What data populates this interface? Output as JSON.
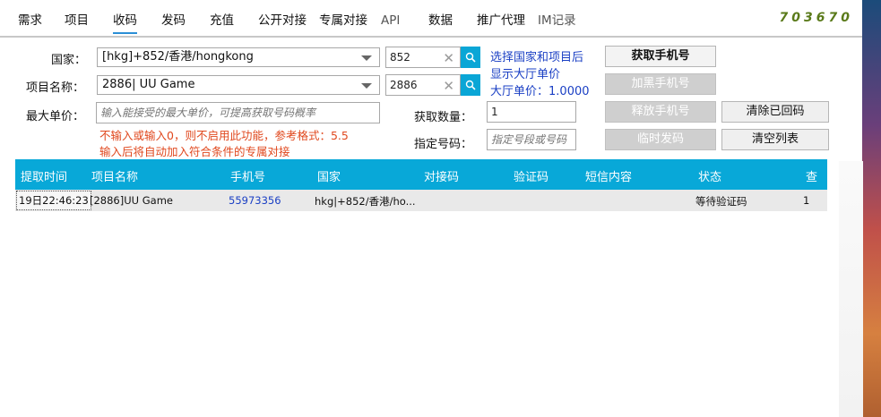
{
  "nav": {
    "tabs": [
      {
        "label": "需求"
      },
      {
        "label": "项目"
      },
      {
        "label": "收码"
      },
      {
        "label": "发码"
      },
      {
        "label": "充值"
      },
      {
        "label": "公开对接"
      },
      {
        "label": "专属对接"
      },
      {
        "label": "API"
      },
      {
        "label": "数据"
      },
      {
        "label": "推广代理"
      },
      {
        "label": "IM记录"
      }
    ],
    "active_tab": "收码",
    "code": "703670"
  },
  "form": {
    "country_label": "国家：",
    "country_value": "[hkg]+852/香港/hongkong",
    "country_code_value": "852",
    "project_label": "项目名称：",
    "project_value": "2886| UU Game",
    "project_code_value": "2886",
    "max_price_label": "最大单价：",
    "max_price_placeholder": "输入能接受的最大单价，可提高获取号码概率",
    "hint_line1": "不输入或输入0，则不启用此功能，参考格式：5.5",
    "hint_line2": "输入后将自动加入符合条件的专属对接",
    "info_line1": "选择国家和项目后",
    "info_line2": "显示大厅单价",
    "hall_price_label": "大厅单价：",
    "hall_price_value": "1.0000",
    "quantity_label": "获取数量：",
    "quantity_value": "1",
    "specify_label": "指定号码：",
    "specify_placeholder": "指定号段或号码"
  },
  "buttons": {
    "get_number": "获取手机号",
    "blacklist": "加黑手机号",
    "release": "释放手机号",
    "clear_returned": "清除已回码",
    "temp_send": "临时发码",
    "clear_list": "清空列表"
  },
  "table": {
    "headers": [
      "提取时间",
      "项目名称",
      "手机号",
      "国家",
      "对接码",
      "验证码",
      "短信内容",
      "状态",
      "查"
    ],
    "rows": [
      {
        "time": "19日22:46:23",
        "project": "[2886]UU Game",
        "phone": "55973356",
        "country": "hkg|+852/香港/ho...",
        "dock_code": "",
        "verify_code": "",
        "sms": "",
        "status": "等待验证码",
        "check": "1"
      }
    ]
  }
}
